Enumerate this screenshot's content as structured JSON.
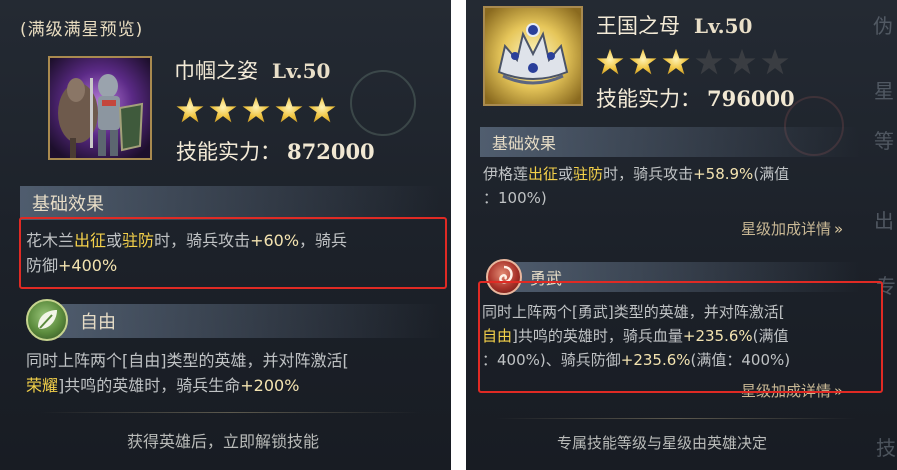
{
  "left": {
    "header": "(满级满星预览)",
    "skill_name": "巾帼之姿",
    "level": "Lv.50",
    "stars": {
      "filled": 5,
      "total": 5
    },
    "power_label": "技能实力：",
    "power_value": "872000",
    "base_section": "基础效果",
    "base_text": {
      "p1": "花木兰",
      "p2": "出征",
      "p3": "或",
      "p4": "驻防",
      "p5": "时，骑兵攻击",
      "p6": "+60%",
      "p7": "，骑兵",
      "p8": "防御",
      "p9": "+400%"
    },
    "bond_name": "自由",
    "bond_text": {
      "line1": "同时上阵两个[自由]类型的英雄，并对阵激活[",
      "line2_a": "荣耀",
      "line2_b": "]共鸣的英雄时，骑兵生命",
      "line2_c": "+200%"
    },
    "footer": "获得英雄后，立即解锁技能"
  },
  "right": {
    "skill_name": "王国之母",
    "level": "Lv.50",
    "stars": {
      "filled": 3,
      "total": 6
    },
    "power_label": "技能实力：",
    "power_value": "796000",
    "base_section": "基础效果",
    "base_text": {
      "p1": "伊格莲",
      "p2": "出征",
      "p3": "或",
      "p4": "驻防",
      "p5": "时，骑兵攻击",
      "p6": "+58.9%",
      "p7": "(满值",
      "p8": "：100%)"
    },
    "details_link": "星级加成详情",
    "bond_name": "勇武",
    "bond_text": {
      "line1": "同时上阵两个[勇武]类型的英雄，并对阵激活[",
      "line2_a": "自由",
      "line2_b": "]共鸣的英雄时，骑兵血量",
      "line2_c": "+235.6%",
      "line2_d": "(满值",
      "line3_a": "：400%)、骑兵防御",
      "line3_b": "+235.6%",
      "line3_c": "(满值：400%)"
    },
    "details_link_2": "星级加成详情",
    "footer": "专属技能等级与星级由英雄决定",
    "edge_chars": [
      "伪",
      "星",
      "等",
      "出",
      "专",
      "技"
    ]
  },
  "colors": {
    "highlight": "#f4d14a",
    "annotation_box": "#e02a24",
    "panel_bg": "#1c2129"
  }
}
